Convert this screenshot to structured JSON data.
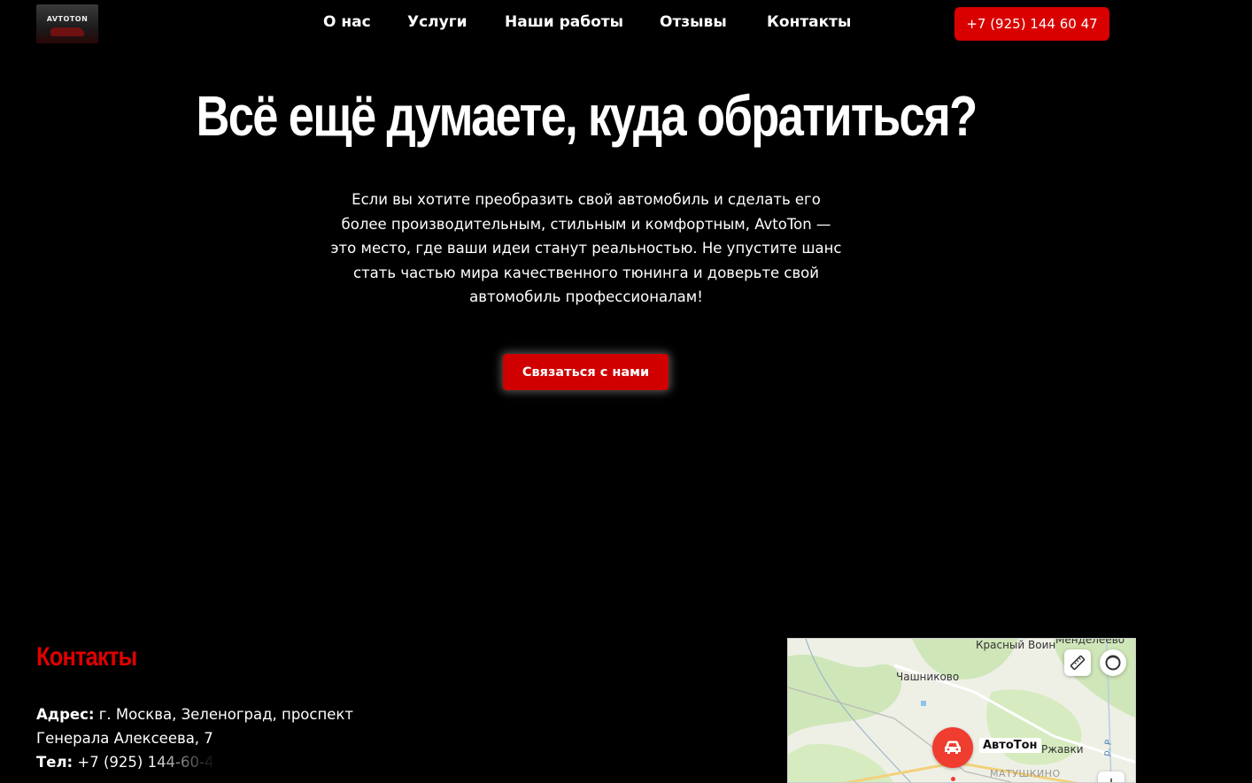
{
  "header": {
    "logo_text": "AVTOTON",
    "nav": [
      {
        "label": "О нас",
        "id": "about"
      },
      {
        "label": "Услуги",
        "id": "services"
      },
      {
        "label": "Наши работы",
        "id": "works"
      },
      {
        "label": "Отзывы",
        "id": "reviews"
      },
      {
        "label": "Контакты",
        "id": "contacts"
      }
    ],
    "phone_label": "+7 (925) 144 60 47"
  },
  "hero": {
    "title": "Всё ещё думаете, куда обратиться?",
    "text": "Если вы хотите преобразить свой автомобиль и сделать его более производительным, стильным и комфортным, AvtoTon — это место, где ваши идеи станут реальностью. Не упустите шанс стать частью мира качественного тюнинга и доверьте свой автомобиль профессионалам!",
    "cta_label": "Связаться с нами"
  },
  "contacts": {
    "title": "Контакты",
    "address_label": "Адрес:",
    "address_value": " г. Москва, Зеленоград, проспект Генерала Алексеева, 7",
    "phone_label": "Тел:",
    "phone_value": " +7 (925) 144-60-4"
  },
  "map": {
    "labels": {
      "krasny_voin": "Красный Воин",
      "mendeleevo": "Менделеево",
      "chashnikovo": "Чашниково",
      "rzhavki": "Ржавки",
      "matushkino": "МАТУШКИНО",
      "river": "р. Р"
    },
    "pin_label": "АвтоТон",
    "zoom_in_label": "+"
  },
  "colors": {
    "accent": "#d90000",
    "background": "#000000",
    "contacts_title": "#e00000",
    "map_pin": "#ef3d2f"
  },
  "icons": {
    "ruler": "ruler-icon",
    "map_layers": "map-layers-icon",
    "car": "car-icon"
  }
}
